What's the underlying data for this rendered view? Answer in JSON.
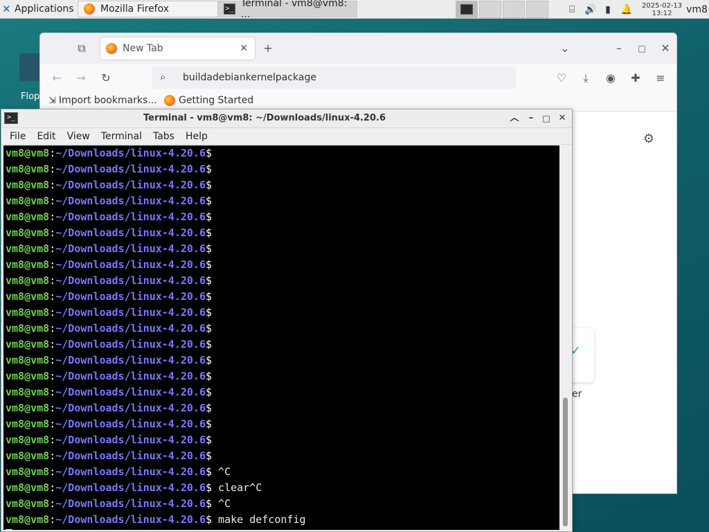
{
  "panel": {
    "apps_label": "Applications",
    "tasks": [
      {
        "label": "Mozilla Firefox",
        "icon": "firefox-icon"
      },
      {
        "label": "Terminal - vm8@vm8: ...",
        "icon": "terminal-icon"
      }
    ],
    "clock_date": "2025-02-13",
    "clock_time": "13:12",
    "user": "vm8"
  },
  "desktop": {
    "icon_label": "Flop"
  },
  "firefox": {
    "tab_label": "New Tab",
    "url": "buildadebiankernelpackage",
    "bookmarks": [
      {
        "label": "Import bookmarks..."
      },
      {
        "label": "Getting Started"
      }
    ],
    "tile_label": "er"
  },
  "terminal": {
    "title": "Terminal - vm8@vm8: ~/Downloads/linux-4.20.6",
    "menu": [
      "File",
      "Edit",
      "View",
      "Terminal",
      "Tabs",
      "Help"
    ],
    "user_host": "vm8@vm8",
    "colon": ":",
    "path": "~/Downloads/linux-4.20.6",
    "dollar": "$",
    "lines": [
      "",
      "",
      "",
      "",
      "",
      "",
      "",
      "",
      "",
      "",
      "",
      "",
      "",
      "",
      "",
      "",
      "",
      "",
      "",
      "",
      " ^C",
      " clear^C",
      " ^C",
      " make defconfig"
    ]
  },
  "colors": {
    "user": "#6ed24a",
    "path": "#7878ff",
    "terminal_bg": "#000000"
  }
}
